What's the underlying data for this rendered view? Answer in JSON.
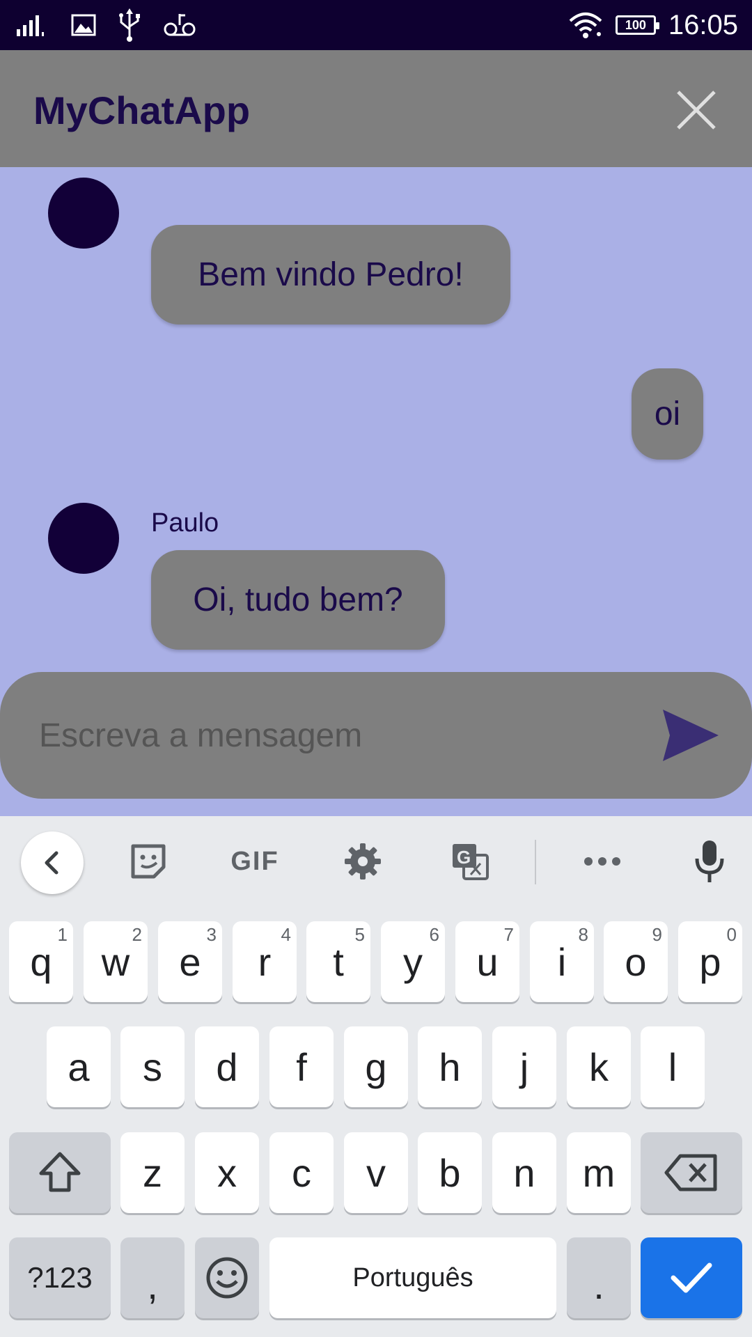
{
  "status_bar": {
    "time": "16:05",
    "battery": "100"
  },
  "app_bar": {
    "title": "MyChatApp"
  },
  "messages": [
    {
      "text": "Bem vindo Pedro!",
      "sender": ""
    },
    {
      "text": "oi",
      "sender": ""
    },
    {
      "text": "Oi, tudo bem?",
      "sender": "Paulo"
    }
  ],
  "composer": {
    "placeholder": "Escreva a mensagem"
  },
  "keyboard": {
    "toolbar": {
      "gif_label": "GIF"
    },
    "row1": [
      {
        "k": "q",
        "h": "1"
      },
      {
        "k": "w",
        "h": "2"
      },
      {
        "k": "e",
        "h": "3"
      },
      {
        "k": "r",
        "h": "4"
      },
      {
        "k": "t",
        "h": "5"
      },
      {
        "k": "y",
        "h": "6"
      },
      {
        "k": "u",
        "h": "7"
      },
      {
        "k": "i",
        "h": "8"
      },
      {
        "k": "o",
        "h": "9"
      },
      {
        "k": "p",
        "h": "0"
      }
    ],
    "row2": [
      "a",
      "s",
      "d",
      "f",
      "g",
      "h",
      "j",
      "k",
      "l"
    ],
    "row3": [
      "z",
      "x",
      "c",
      "v",
      "b",
      "n",
      "m"
    ],
    "symbols_label": "?123",
    "comma_label": ",",
    "space_label": "Português",
    "period_label": ".",
    "colors": {
      "enter": "#1a73e8",
      "app_bar": "#7f7f7f",
      "chat_bg": "#aab0e6",
      "status_bar": "#0e0030"
    }
  }
}
